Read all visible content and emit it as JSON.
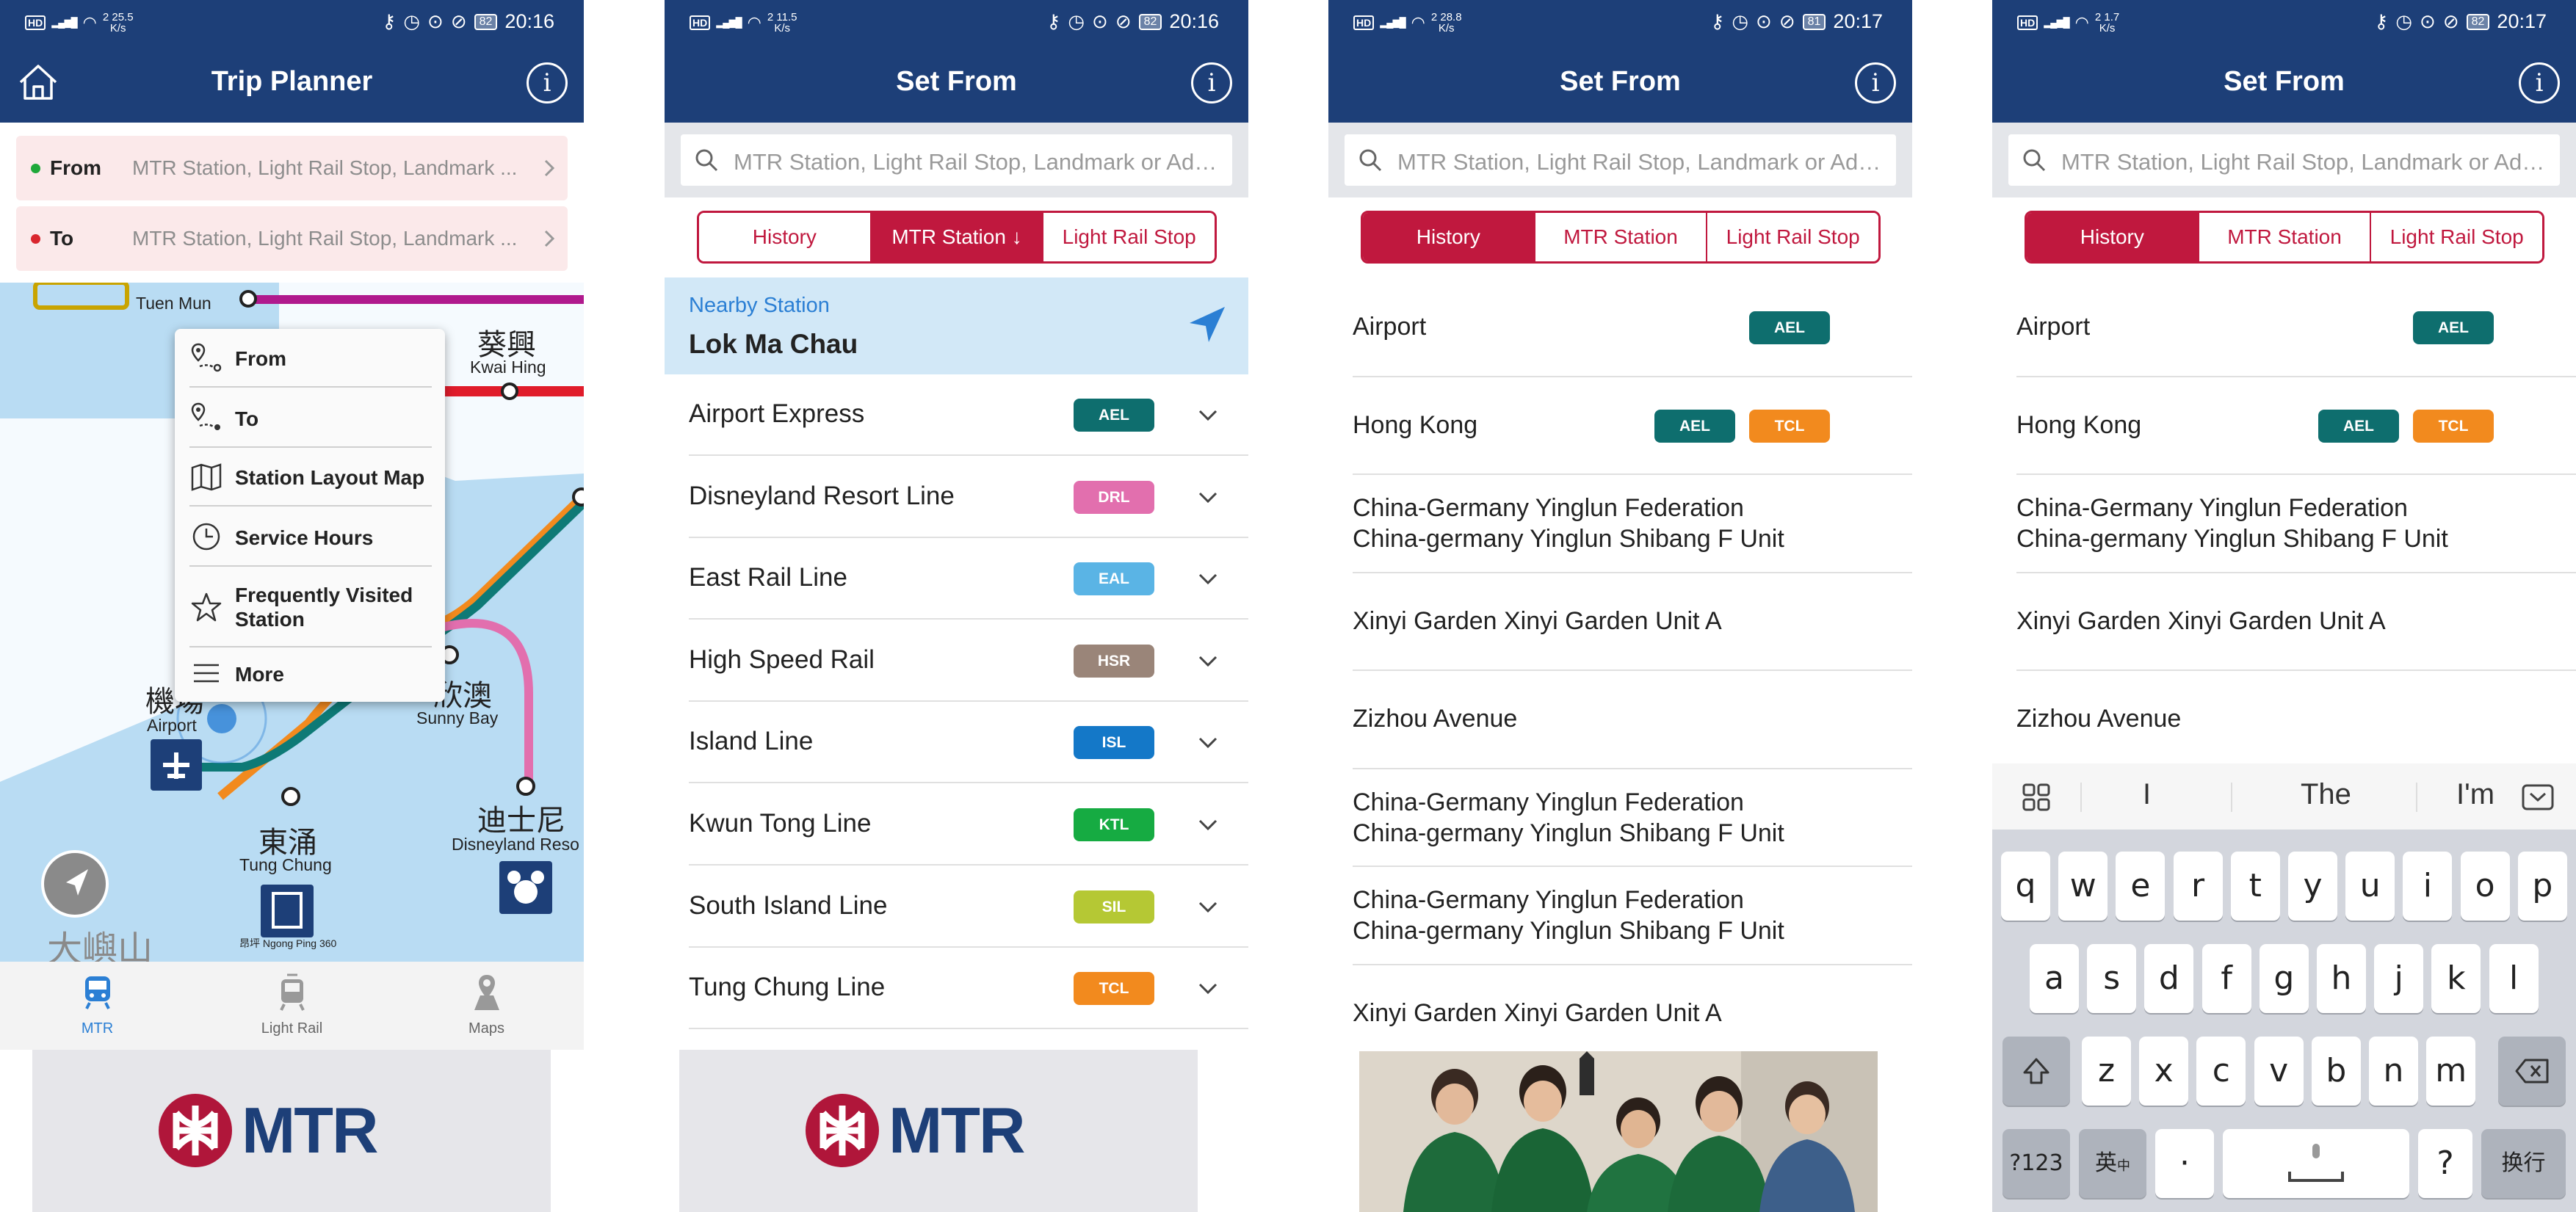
{
  "status": {
    "p1": {
      "speed": "25.5",
      "unit": "K/s",
      "sim": "2",
      "battery": "82",
      "time": "20:16"
    },
    "p2": {
      "speed": "11.5",
      "unit": "K/s",
      "sim": "2",
      "battery": "82",
      "time": "20:16"
    },
    "p3": {
      "speed": "28.8",
      "unit": "K/s",
      "sim": "2",
      "battery": "81",
      "time": "20:17"
    },
    "p4": {
      "speed": "1.7",
      "unit": "K/s",
      "sim": "2",
      "battery": "82",
      "time": "20:17"
    }
  },
  "trip_planner": {
    "title": "Trip Planner",
    "from_label": "From",
    "to_label": "To",
    "placeholder": "MTR Station, Light Rail Stop, Landmark ...",
    "menu": [
      "From",
      "To",
      "Station Layout Map",
      "Service Hours",
      "Frequently Visited Station",
      "More"
    ],
    "map_labels": {
      "tuen_mun": "Tuen Mun",
      "kwai_hing_cjk": "葵興",
      "kwai_hing": "Kwai Hing",
      "airport_cjk": "機場",
      "airport": "Airport",
      "sunny_bay_cjk": "欣澳",
      "sunny_bay": "Sunny Bay",
      "tung_chung_cjk": "東涌",
      "tung_chung": "Tung Chung",
      "disneyland_cjk": "迪士尼",
      "disneyland": "Disneyland Reso",
      "ngong_ping": "昂坪 Ngong Ping 360",
      "lantau_cjk": "大嶼山"
    },
    "nav": [
      "MTR",
      "Light Rail",
      "Maps"
    ]
  },
  "set_from": {
    "title": "Set From",
    "search_placeholder": "MTR Station, Light Rail Stop, Landmark or Addr...",
    "tabs": [
      "History",
      "MTR Station",
      "Light Rail Stop"
    ],
    "mtr_tab_sorted": "MTR Station ↓",
    "nearby_label": "Nearby Station",
    "nearby_station": "Lok Ma Chau",
    "lines": [
      {
        "name": "Airport Express",
        "code": "AEL",
        "color": "#0e6e6e"
      },
      {
        "name": "Disneyland Resort Line",
        "code": "DRL",
        "color": "#e26fae"
      },
      {
        "name": "East Rail Line",
        "code": "EAL",
        "color": "#5ab4e5"
      },
      {
        "name": "High Speed Rail",
        "code": "HSR",
        "color": "#9a8579"
      },
      {
        "name": "Island Line",
        "code": "ISL",
        "color": "#1478c8"
      },
      {
        "name": "Kwun Tong Line",
        "code": "KTL",
        "color": "#16ab42"
      },
      {
        "name": "South Island Line",
        "code": "SIL",
        "color": "#b5c834"
      },
      {
        "name": "Tung Chung Line",
        "code": "TCL",
        "color": "#f28a1e"
      }
    ],
    "history": [
      {
        "line1": "Airport",
        "badges": [
          "AEL"
        ]
      },
      {
        "line1": "Hong Kong",
        "badges": [
          "AEL",
          "TCL"
        ]
      },
      {
        "line1": "China-Germany Yinglun Federation",
        "line2": "China-germany Yinglun Shibang F Unit"
      },
      {
        "line1": "Xinyi Garden Xinyi Garden Unit A"
      },
      {
        "line1": "Zizhou Avenue"
      },
      {
        "line1": "China-Germany Yinglun Federation",
        "line2": "China-germany Yinglun Shibang F Unit"
      },
      {
        "line1": "China-Germany Yinglun Federation",
        "line2": "China-germany Yinglun Shibang F Unit"
      },
      {
        "line1": "Xinyi Garden Xinyi Garden Unit A"
      }
    ]
  },
  "banner": {
    "brand": "MTR"
  },
  "keyboard": {
    "suggestions": [
      "I",
      "The",
      "I'm"
    ],
    "row1": [
      "q",
      "w",
      "e",
      "r",
      "t",
      "y",
      "u",
      "i",
      "o",
      "p"
    ],
    "row2": [
      "a",
      "s",
      "d",
      "f",
      "g",
      "h",
      "j",
      "k",
      "l"
    ],
    "row3": [
      "z",
      "x",
      "c",
      "v",
      "b",
      "n",
      "m"
    ],
    "num_key": "?123",
    "lang_key": "英",
    "lang_sub": "中",
    "dot_key": "·",
    "question_key": "?",
    "enter_key": "换行"
  },
  "colors": {
    "navy": "#1d3f78",
    "mtr_red": "#c0183e",
    "link_blue": "#2b7fd4",
    "map_water": "#b9dcf3"
  }
}
